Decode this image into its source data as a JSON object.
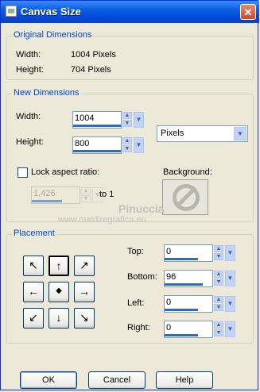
{
  "window": {
    "title": "Canvas Size",
    "close": "✕"
  },
  "original": {
    "group_label": "Original Dimensions",
    "width_label": "Width:",
    "width_value": "1004 Pixels",
    "height_label": "Height:",
    "height_value": "704 Pixels"
  },
  "new_dims": {
    "group_label": "New Dimensions",
    "width_label": "Width:",
    "width_value": "1004",
    "height_label": "Height:",
    "height_value": "800",
    "units": "Pixels",
    "lock_label": "Lock aspect ratio:",
    "lock_checked": false,
    "ratio_value": "1,426",
    "ratio_suffix": "to 1",
    "background_label": "Background:"
  },
  "placement": {
    "group_label": "Placement",
    "arrows": [
      "↖",
      "↑",
      "↗",
      "←",
      "◆",
      "→",
      "↙",
      "↓",
      "↘"
    ],
    "top_label": "Top:",
    "top_value": "0",
    "bottom_label": "Bottom:",
    "bottom_value": "96",
    "left_label": "Left:",
    "left_value": "0",
    "right_label": "Right:",
    "right_value": "0"
  },
  "watermark": {
    "name": "Pinuccia",
    "url": "www.maidiregrafica.eu"
  },
  "buttons": {
    "ok": "OK",
    "cancel": "Cancel",
    "help": "Help"
  }
}
